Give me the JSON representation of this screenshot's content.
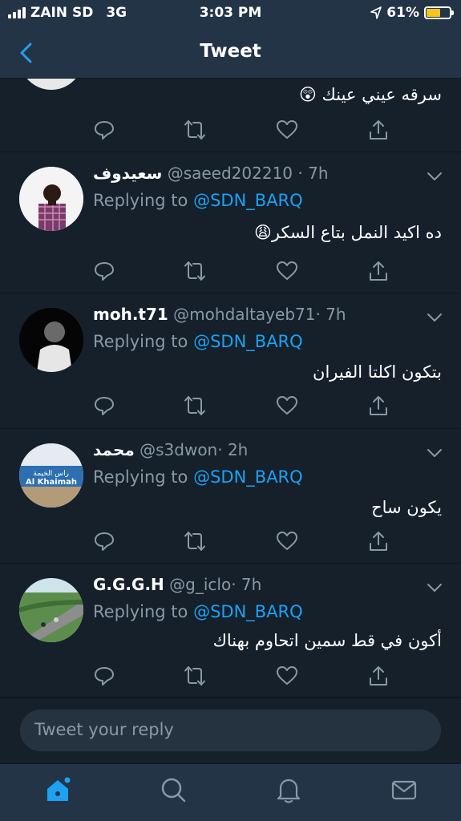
{
  "status": {
    "carrier": "ZAIN SD",
    "network": "3G",
    "time": "3:03 PM",
    "battery": "61%",
    "battery_level": 0.61
  },
  "header": {
    "title": "Tweet"
  },
  "colors": {
    "background": "#15202b",
    "bar": "#243447",
    "accent": "#1da1f2",
    "muted": "#8899a6",
    "battery": "#f5c518"
  },
  "tweets": [
    {
      "name": "",
      "handle": "",
      "time": "",
      "reply_prefix": "",
      "reply_to": "",
      "text": "سرقه عيني عينك 😲"
    },
    {
      "name": "سعيدوف",
      "handle": "@saeed202210",
      "time": "· 7h",
      "reply_prefix": "Replying to ",
      "reply_to": "@SDN_BARQ",
      "text": "ده اكيد النمل بتاع السكر😩"
    },
    {
      "name": "moh.t71",
      "handle": "@mohdaltayeb71",
      "time": "· 7h",
      "reply_prefix": "Replying to ",
      "reply_to": "@SDN_BARQ",
      "text": "بتكون اكلتا الفيران"
    },
    {
      "name": "محمد",
      "handle": "@s3dwon",
      "time": "· 2h",
      "reply_prefix": "Replying to ",
      "reply_to": "@SDN_BARQ",
      "text": "يكون ساح",
      "avatar_sign_text_ar": "راس الخيمة",
      "avatar_sign_text_en": "Al Khaimah"
    },
    {
      "name": "G.G.G.H",
      "handle": "@g_iclo",
      "time": "· 7h",
      "reply_prefix": "Replying to ",
      "reply_to": "@SDN_BARQ",
      "text": "أكون في قط سمين اتحاوم بهناك"
    }
  ],
  "composer": {
    "placeholder": "Tweet your reply"
  },
  "icons": {
    "reply": "reply-icon",
    "retweet": "retweet-icon",
    "like": "heart-icon",
    "share": "share-icon",
    "home": "home-icon",
    "search": "search-icon",
    "notifications": "bell-icon",
    "messages": "mail-icon"
  }
}
